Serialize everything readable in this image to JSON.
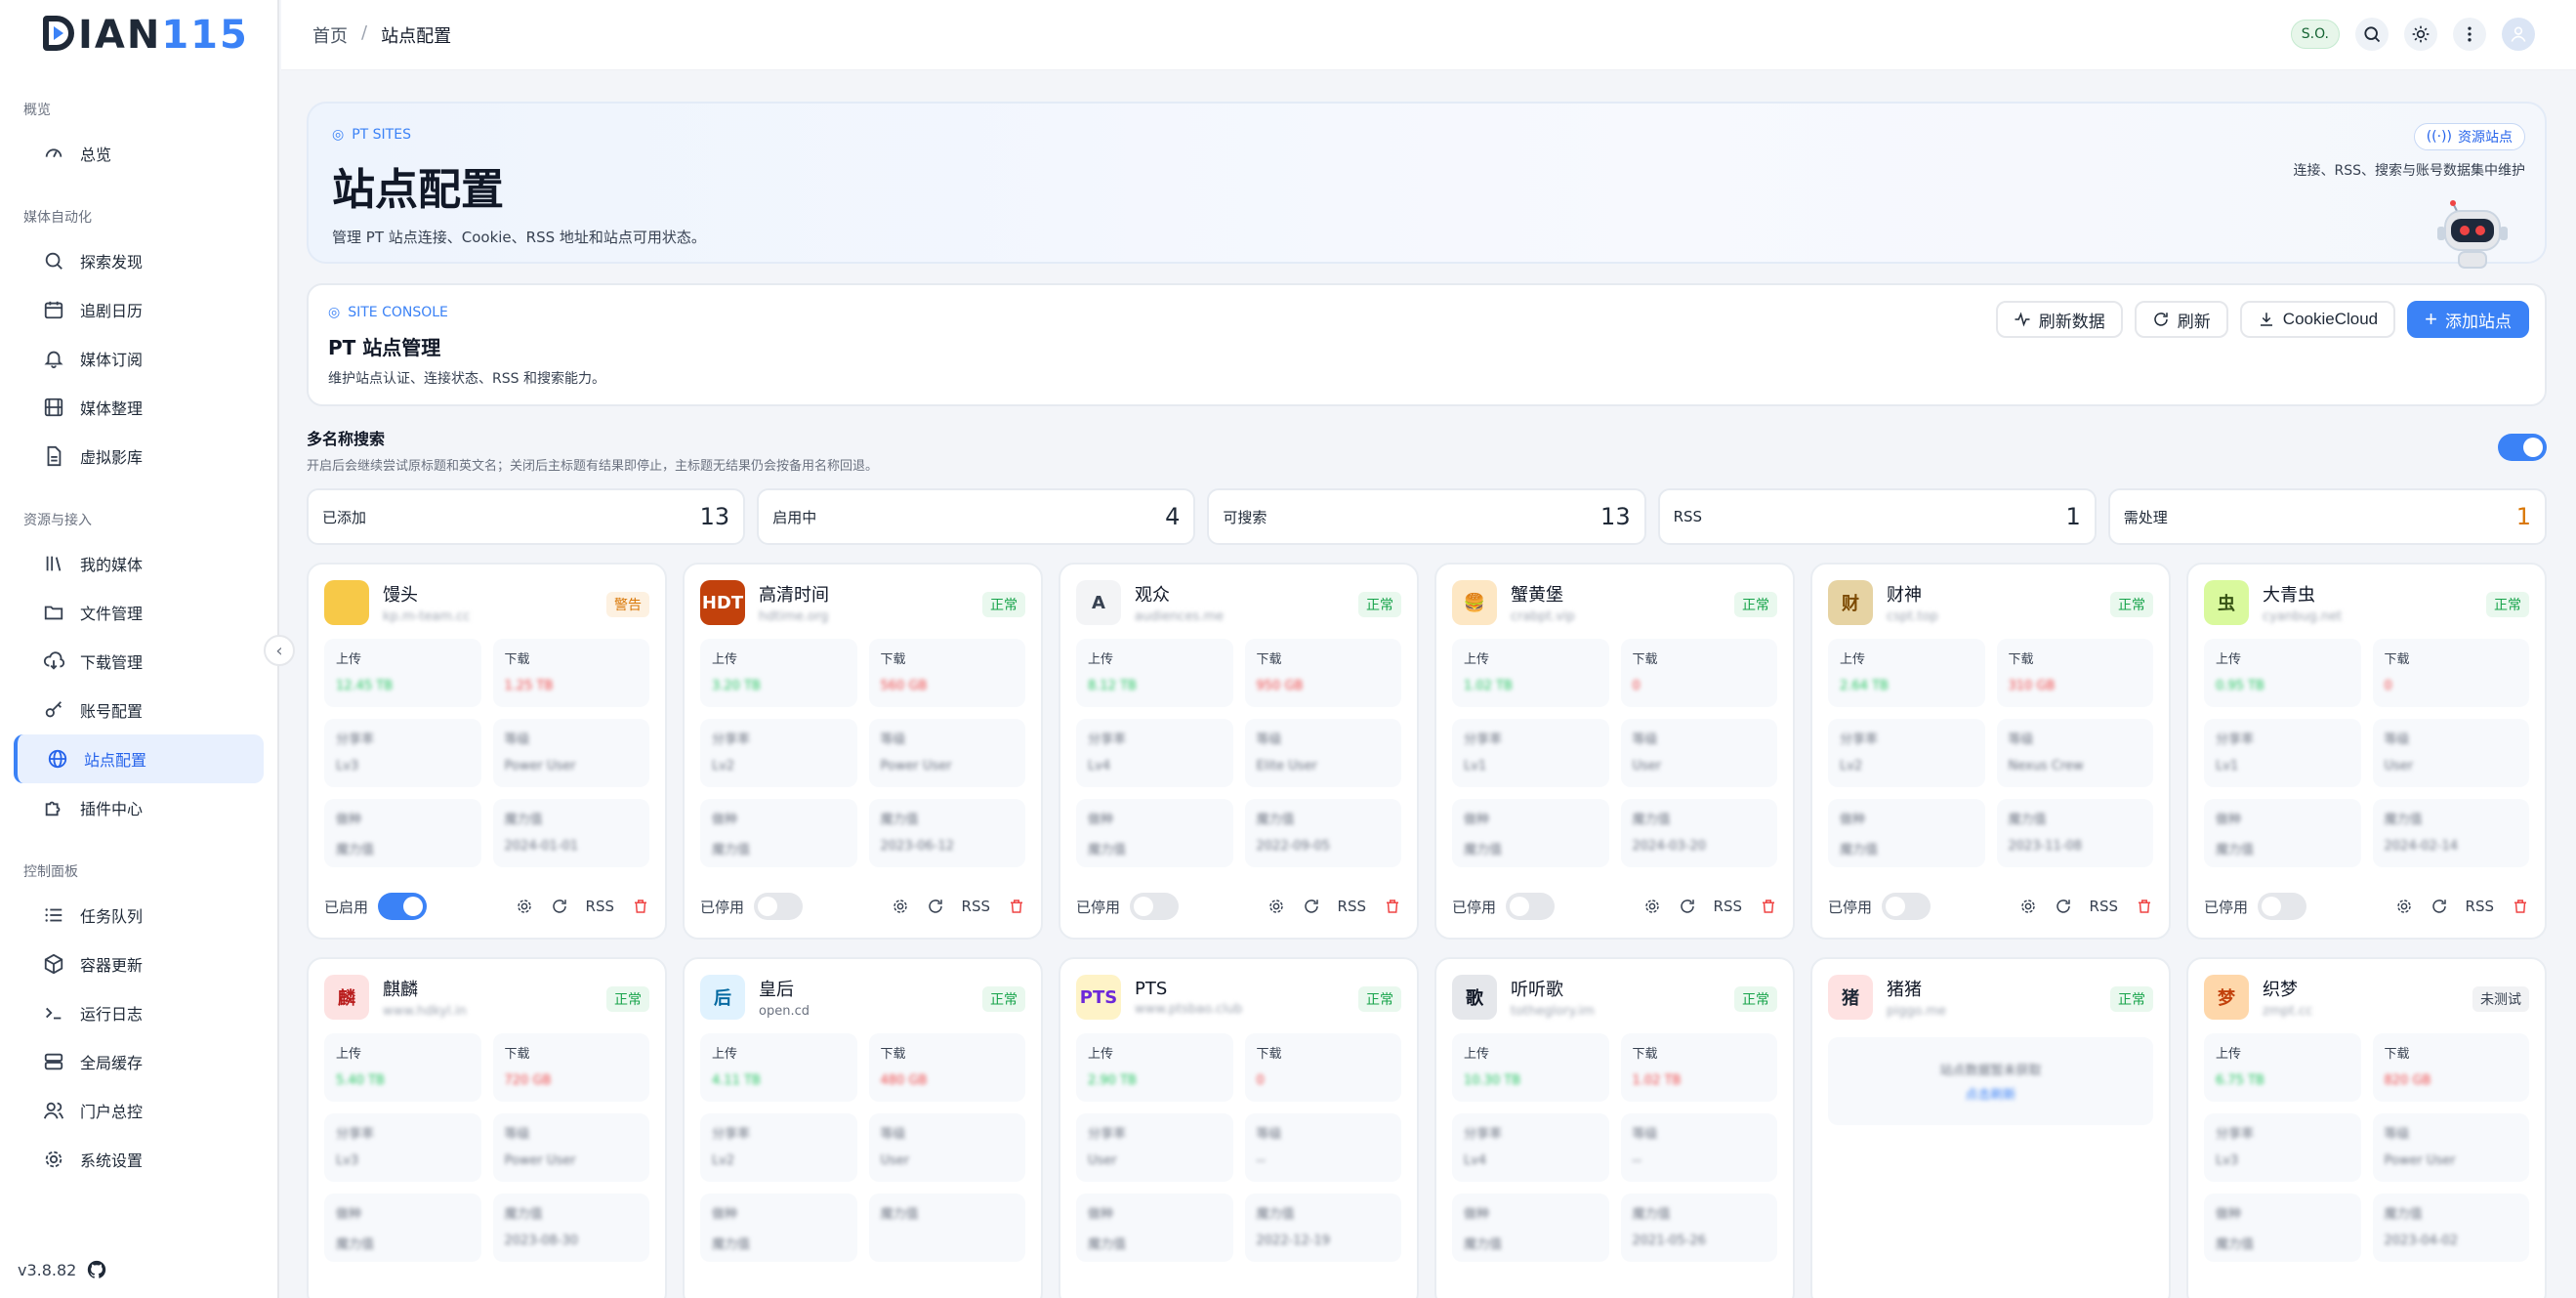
{
  "brand": {
    "logo_main": "IAN",
    "logo_accent": "115",
    "logo_prefix": "D"
  },
  "sidebar": {
    "groups": [
      {
        "title": "概览",
        "items": [
          {
            "label": "总览",
            "icon": "gauge-icon"
          }
        ]
      },
      {
        "title": "媒体自动化",
        "items": [
          {
            "label": "探索发现",
            "icon": "search-icon"
          },
          {
            "label": "追剧日历",
            "icon": "calendar-icon"
          },
          {
            "label": "媒体订阅",
            "icon": "bell-icon"
          },
          {
            "label": "媒体整理",
            "icon": "film-icon"
          },
          {
            "label": "虚拟影库",
            "icon": "file-icon"
          }
        ]
      },
      {
        "title": "资源与接入",
        "items": [
          {
            "label": "我的媒体",
            "icon": "library-icon"
          },
          {
            "label": "文件管理",
            "icon": "folder-icon"
          },
          {
            "label": "下载管理",
            "icon": "download-cloud-icon"
          },
          {
            "label": "账号配置",
            "icon": "key-icon"
          },
          {
            "label": "站点配置",
            "icon": "globe-icon",
            "active": true
          },
          {
            "label": "插件中心",
            "icon": "puzzle-icon"
          }
        ]
      },
      {
        "title": "控制面板",
        "items": [
          {
            "label": "任务队列",
            "icon": "list-icon"
          },
          {
            "label": "容器更新",
            "icon": "box-icon"
          },
          {
            "label": "运行日志",
            "icon": "terminal-icon"
          },
          {
            "label": "全局缓存",
            "icon": "server-icon"
          },
          {
            "label": "门户总控",
            "icon": "users-icon"
          },
          {
            "label": "系统设置",
            "icon": "gear-icon"
          }
        ]
      }
    ],
    "version": "v3.8.82"
  },
  "topbar": {
    "breadcrumb": [
      "首页",
      "站点配置"
    ],
    "separator": "/",
    "badge": "S.O."
  },
  "hero": {
    "tag": "PT SITES",
    "title": "站点配置",
    "subtitle": "管理 PT 站点连接、Cookie、RSS 地址和站点可用状态。",
    "badge": "资源站点",
    "desc": "连接、RSS、搜索与账号数据集中维护"
  },
  "console": {
    "tag": "SITE CONSOLE",
    "title": "PT 站点管理",
    "subtitle": "维护站点认证、连接状态、RSS 和搜索能力。",
    "buttons": {
      "refresh_data": "刷新数据",
      "refresh": "刷新",
      "cookiecloud": "CookieCloud",
      "add_site": "添加站点"
    }
  },
  "multi_search": {
    "title": "多名称搜索",
    "subtitle": "开启后会继续尝试原标题和英文名；关闭后主标题有结果即停止，主标题无结果仍会按备用名称回退。",
    "enabled": true
  },
  "stats": [
    {
      "label": "已添加",
      "value": "13"
    },
    {
      "label": "启用中",
      "value": "4"
    },
    {
      "label": "可搜索",
      "value": "13"
    },
    {
      "label": "RSS",
      "value": "1"
    },
    {
      "label": "需处理",
      "value": "1",
      "warn": true
    }
  ],
  "common": {
    "upload": "上传",
    "download": "下载",
    "rss": "RSS",
    "enabled": "已启用",
    "disabled": "已停用"
  },
  "sites": [
    {
      "name": "馒头",
      "status": "警告",
      "status_type": "warn",
      "icon_text": "",
      "enabled": true,
      "domain": "kp.m-team.cc",
      "colors": {
        "bg": "#f7c948",
        "fg": "#3b2a00"
      },
      "m": [
        "12.45 TB",
        "1.25 TB",
        "分享率",
        "等级",
        "Power User",
        "Lv3",
        "做种",
        "魔力值",
        "2024-01-01"
      ]
    },
    {
      "name": "高清时间",
      "status": "正常",
      "status_type": "ok",
      "icon_text": "HDT",
      "enabled": false,
      "domain": "hdtime.org",
      "colors": {
        "bg": "#c2410c",
        "fg": "#ffffff"
      },
      "m": [
        "3.20 TB",
        "560 GB",
        "分享率",
        "等级",
        "Power User",
        "Lv2",
        "做种",
        "魔力值",
        "2023-06-12"
      ]
    },
    {
      "name": "观众",
      "status": "正常",
      "status_type": "ok",
      "icon_text": "A",
      "enabled": false,
      "domain": "audiences.me",
      "colors": {
        "bg": "#f3f4f6",
        "fg": "#374151"
      },
      "m": [
        "8.12 TB",
        "950 GB",
        "分享率",
        "等级",
        "Elite User",
        "Lv4",
        "做种",
        "魔力值",
        "2022-09-05"
      ]
    },
    {
      "name": "蟹黄堡",
      "status": "正常",
      "status_type": "ok",
      "icon_text": "🍔",
      "enabled": false,
      "domain": "crabpt.vip",
      "colors": {
        "bg": "#fde7c4",
        "fg": "#7c2d12"
      },
      "m": [
        "1.02 TB",
        "0",
        "分享率",
        "等级",
        "User",
        "Lv1",
        "做种",
        "魔力值",
        "2024-03-20"
      ]
    },
    {
      "name": "财神",
      "status": "正常",
      "status_type": "ok",
      "icon_text": "财",
      "enabled": false,
      "domain": "cspt.top",
      "colors": {
        "bg": "#e6d3a3",
        "fg": "#7c4a03"
      },
      "m": [
        "2.64 TB",
        "310 GB",
        "分享率",
        "等级",
        "Nexus Crew",
        "Lv2",
        "做种",
        "魔力值",
        "2023-11-08"
      ]
    },
    {
      "name": "大青虫",
      "status": "正常",
      "status_type": "ok",
      "icon_text": "虫",
      "enabled": false,
      "domain": "cyanbug.net",
      "colors": {
        "bg": "#d9f99d",
        "fg": "#365314"
      },
      "m": [
        "0.95 TB",
        "0",
        "分享率",
        "等级",
        "User",
        "Lv1",
        "做种",
        "魔力值",
        "2024-02-14"
      ]
    },
    {
      "name": "麒麟",
      "status": "正常",
      "status_type": "ok",
      "icon_text": "麟",
      "enabled": false,
      "domain": "www.hdkyl.in",
      "colors": {
        "bg": "#fde2e2",
        "fg": "#b91c1c"
      },
      "m": [
        "5.40 TB",
        "720 GB",
        "分享率",
        "等级",
        "Power User",
        "Lv3",
        "做种",
        "魔力值",
        "2023-08-30"
      ]
    },
    {
      "name": "皇后",
      "status": "正常",
      "status_type": "ok",
      "icon_text": "后",
      "enabled": false,
      "domain": "open.cd",
      "domain_clear": true,
      "colors": {
        "bg": "#e0f2fe",
        "fg": "#0369a1"
      },
      "m": [
        "4.11 TB",
        "480 GB",
        "分享率",
        "等级",
        "User",
        "Lv2",
        "做种",
        "魔力值",
        ""
      ]
    },
    {
      "name": "PTS",
      "status": "正常",
      "status_type": "ok",
      "icon_text": "PTS",
      "enabled": false,
      "domain": "www.ptsbao.club",
      "colors": {
        "bg": "#fef3c7",
        "fg": "#6d28d9"
      },
      "m": [
        "2.90 TB",
        "0",
        "分享率",
        "等级",
        "--",
        "User",
        "做种",
        "魔力值",
        "2022-12-19"
      ]
    },
    {
      "name": "听听歌",
      "status": "正常",
      "status_type": "ok",
      "icon_text": "歌",
      "enabled": false,
      "domain": "totheglory.im",
      "colors": {
        "bg": "#e5e7eb",
        "fg": "#111827"
      },
      "m": [
        "10.30 TB",
        "1.02 TB",
        "分享率",
        "等级",
        "--",
        "Lv4",
        "做种",
        "魔力值",
        "2021-05-26"
      ]
    },
    {
      "name": "猪猪",
      "status": "正常",
      "status_type": "ok",
      "icon_text": "猪",
      "enabled": false,
      "placeholder": true,
      "domain": "piggo.me",
      "colors": {
        "bg": "#fee2e2",
        "fg": "#1f2937"
      },
      "placeholder_lines": [
        "站点数据暂未获取",
        "点击刷新"
      ]
    },
    {
      "name": "织梦",
      "status": "未测试",
      "status_type": "unknown",
      "icon_text": "梦",
      "enabled": false,
      "domain": "zmpt.cc",
      "colors": {
        "bg": "#fed7aa",
        "fg": "#c2410c"
      },
      "m": [
        "6.75 TB",
        "820 GB",
        "分享率",
        "等级",
        "Power User",
        "Lv3",
        "做种",
        "魔力值",
        "2023-04-02"
      ]
    }
  ]
}
